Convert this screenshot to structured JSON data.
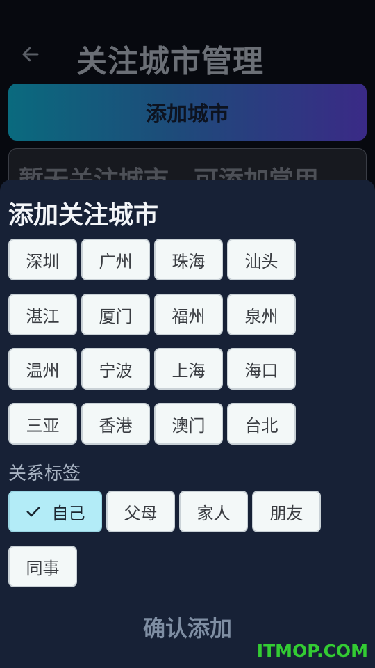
{
  "header": {
    "title": "关注城市管理",
    "back_icon": "arrow-left-icon"
  },
  "page": {
    "add_city_label": "添加城市",
    "empty_message": "暂无关注城市，可添加常用"
  },
  "sheet": {
    "title": "添加关注城市",
    "cities": [
      "深圳",
      "广州",
      "珠海",
      "汕头",
      "湛江",
      "厦门",
      "福州",
      "泉州",
      "温州",
      "宁波",
      "上海",
      "海口",
      "三亚",
      "香港",
      "澳门",
      "台北"
    ],
    "relation_label": "关系标签",
    "relations": [
      "自己",
      "父母",
      "家人",
      "朋友",
      "同事"
    ],
    "selected_relation": "自己",
    "confirm_label": "确认添加"
  },
  "watermark": "ITMOP.COM",
  "colors": {
    "accent_selected": "#b3ecf7",
    "sheet_bg": "#172136",
    "gradient_start": "#0a6a7e",
    "gradient_end": "#3a2a86"
  }
}
